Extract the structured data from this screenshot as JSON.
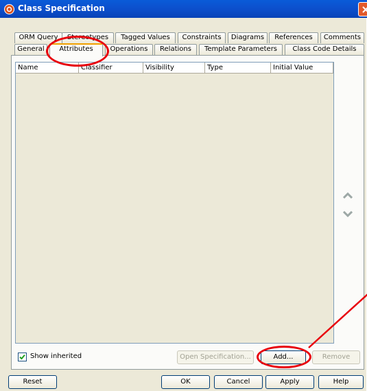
{
  "window": {
    "title": "Class Specification"
  },
  "tabs_row1": [
    {
      "label": "ORM Query"
    },
    {
      "label": "Stereotypes"
    },
    {
      "label": "Tagged Values"
    },
    {
      "label": "Constraints"
    },
    {
      "label": "Diagrams"
    },
    {
      "label": "References"
    },
    {
      "label": "Comments"
    }
  ],
  "tabs_row2": [
    {
      "label": "General"
    },
    {
      "label": "Attributes"
    },
    {
      "label": "Operations"
    },
    {
      "label": "Relations"
    },
    {
      "label": "Template Parameters"
    },
    {
      "label": "Class Code Details"
    }
  ],
  "active_tab": "Attributes",
  "table": {
    "columns": [
      "Name",
      "Classifier",
      "Visibility",
      "Type",
      "Initial Value"
    ],
    "rows": []
  },
  "show_inherited": {
    "label": "Show inherited",
    "checked": true
  },
  "buttons": {
    "open_spec": "Open Specification...",
    "add": "Add...",
    "remove": "Remove",
    "reset": "Reset",
    "ok": "OK",
    "cancel": "Cancel",
    "apply": "Apply",
    "help": "Help"
  },
  "colors": {
    "annotation": "#e8000b",
    "active_tab_accent": "#f0a000"
  }
}
